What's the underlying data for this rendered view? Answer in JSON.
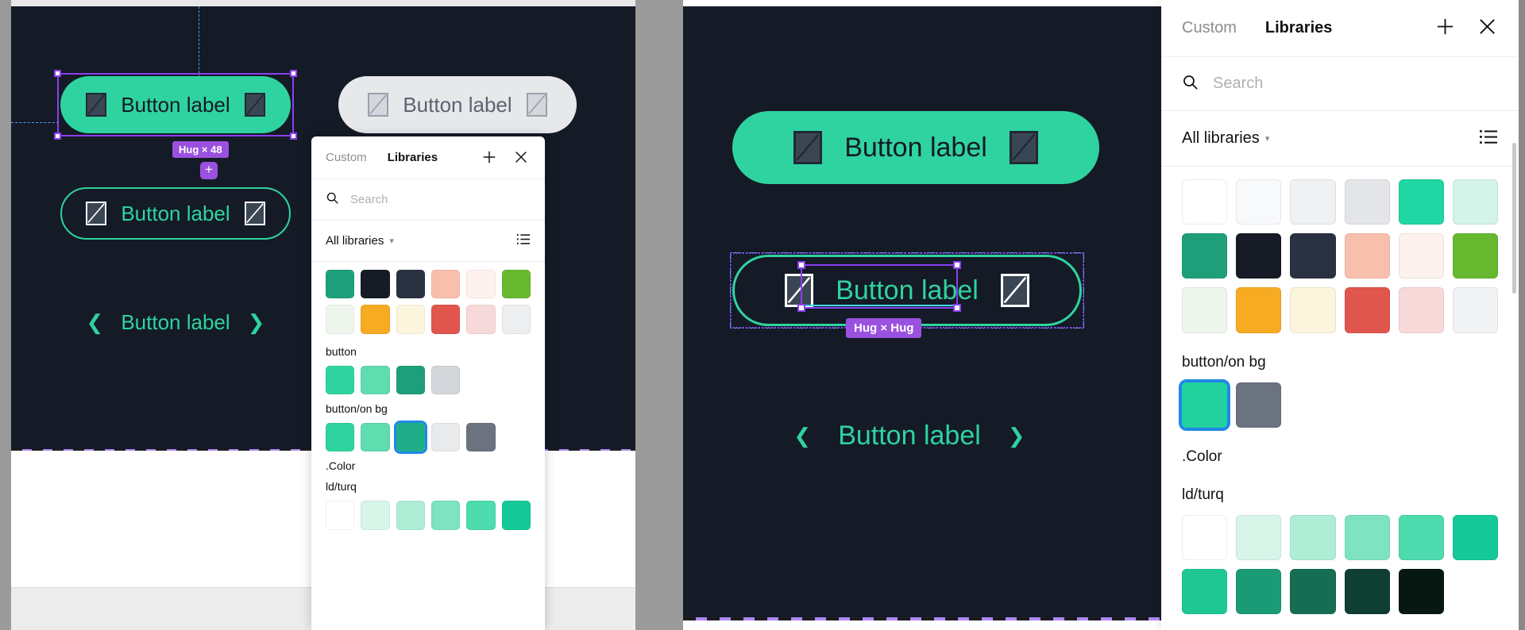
{
  "left_view": {
    "canvas": {
      "background": "#141a26",
      "primary_button": {
        "label": "Button label",
        "bg": "#2fd39f",
        "text_color": "#141a26"
      },
      "outline_button": {
        "label": "Button label",
        "border_color": "#2fd39f",
        "text_color": "#2fd39f"
      },
      "text_button": {
        "label": "Button label",
        "prev_icon": "chevron-left-icon",
        "next_icon": "chevron-right-icon",
        "text_color": "#2fd39f"
      },
      "neutral_button": {
        "label": "Button label",
        "bg": "#e6e8ea",
        "text_color": "#5b6470"
      },
      "selection_badge": "Hug × 48",
      "add_button": "+"
    },
    "popup": {
      "tabs": [
        {
          "label": "Custom",
          "active": false
        },
        {
          "label": "Libraries",
          "active": true
        }
      ],
      "add_icon": "plus-icon",
      "close_icon": "close-icon",
      "search": {
        "placeholder": "Search",
        "value": ""
      },
      "filter": {
        "label": "All libraries",
        "chevron": "chevron-down-icon",
        "list_icon": "list-view-icon"
      },
      "swatch_rows": [
        [
          "#1f9e7a",
          "#161b26",
          "#2a3140",
          "#f9bfad",
          "#fdf2ee",
          "#66b92e"
        ],
        [
          "#eef6ee",
          "#f6ab22",
          "#fcf5dd",
          "#e0564d",
          "#f8d9da",
          "#eceef0"
        ]
      ],
      "groups": [
        {
          "label": "button",
          "swatches": [
            {
              "color": "#2fd39f",
              "selected": false
            },
            {
              "color": "#5fdcb0",
              "selected": false
            },
            {
              "color": "#1f9e7a",
              "selected": false
            },
            {
              "color": "#d3d6da",
              "selected": false
            }
          ]
        },
        {
          "label": "button/on bg",
          "swatches": [
            {
              "color": "#2fd39f",
              "selected": false
            },
            {
              "color": "#5fdcb0",
              "selected": false
            },
            {
              "color": "#1fae88",
              "selected": true
            },
            {
              "color": "#e8eaec",
              "selected": false
            },
            {
              "color": "#6b7280",
              "selected": false
            }
          ]
        },
        {
          "label": ".Color",
          "swatches": []
        },
        {
          "label": "ld/turq",
          "swatches": [
            {
              "color": "#ffffff",
              "selected": false
            },
            {
              "color": "#d8f5ea",
              "selected": false
            },
            {
              "color": "#aeeed6",
              "selected": false
            },
            {
              "color": "#7ee3c0",
              "selected": false
            },
            {
              "color": "#4edbae",
              "selected": false
            },
            {
              "color": "#16c998",
              "selected": false
            }
          ]
        }
      ]
    }
  },
  "right_view": {
    "canvas": {
      "background": "#141a26",
      "primary_button": {
        "label": "Button label",
        "bg": "#2fd39f",
        "text_color": "#141a26"
      },
      "outline_button": {
        "label": "Button label",
        "border_color": "#2fd39f",
        "text_color": "#2fd39f"
      },
      "text_button": {
        "label": "Button label",
        "prev_icon": "chevron-left-icon",
        "next_icon": "chevron-right-icon",
        "text_color": "#2fd39f"
      },
      "selection_badge": "Hug × Hug"
    }
  },
  "right_panel": {
    "tabs": [
      {
        "label": "Custom",
        "active": false
      },
      {
        "label": "Libraries",
        "active": true
      }
    ],
    "add_icon": "plus-icon",
    "close_icon": "close-icon",
    "search": {
      "placeholder": "Search",
      "value": ""
    },
    "filter": {
      "label": "All libraries",
      "chevron": "chevron-down-icon",
      "list_icon": "list-view-icon"
    },
    "swatch_rows": [
      [
        "#ffffff",
        "#f8f9fa",
        "#f0f1f3",
        "#e3e5e8",
        "#20d6a3",
        "#d4f3e9"
      ],
      [
        "#1f9e7a",
        "#161b26",
        "#2a3140",
        "#f9bfad",
        "#fdf2ee",
        "#66b92e"
      ],
      [
        "#eef6ee",
        "#f6ab22",
        "#fcf5dd",
        "#e0564d",
        "#f8d9da",
        "#f2f3f5"
      ]
    ],
    "groups": [
      {
        "label": "button/on bg",
        "swatches": [
          {
            "color": "#21d29d",
            "selected": true
          },
          {
            "color": "#6b7280",
            "selected": false
          }
        ]
      },
      {
        "label": ".Color",
        "swatches": []
      },
      {
        "label": "ld/turq",
        "swatches": [
          {
            "color": "#ffffff",
            "selected": false
          },
          {
            "color": "#d8f5ea",
            "selected": false
          },
          {
            "color": "#aeeed6",
            "selected": false
          },
          {
            "color": "#7ee3c0",
            "selected": false
          },
          {
            "color": "#4edbae",
            "selected": false
          },
          {
            "color": "#16c998",
            "selected": false
          }
        ]
      },
      {
        "label": "",
        "swatches": [
          {
            "color": "#1fc893",
            "selected": false
          },
          {
            "color": "#1a9b75",
            "selected": false
          },
          {
            "color": "#156d54",
            "selected": false
          },
          {
            "color": "#0f3f33",
            "selected": false
          },
          {
            "color": "#071812",
            "selected": false
          }
        ]
      }
    ]
  }
}
